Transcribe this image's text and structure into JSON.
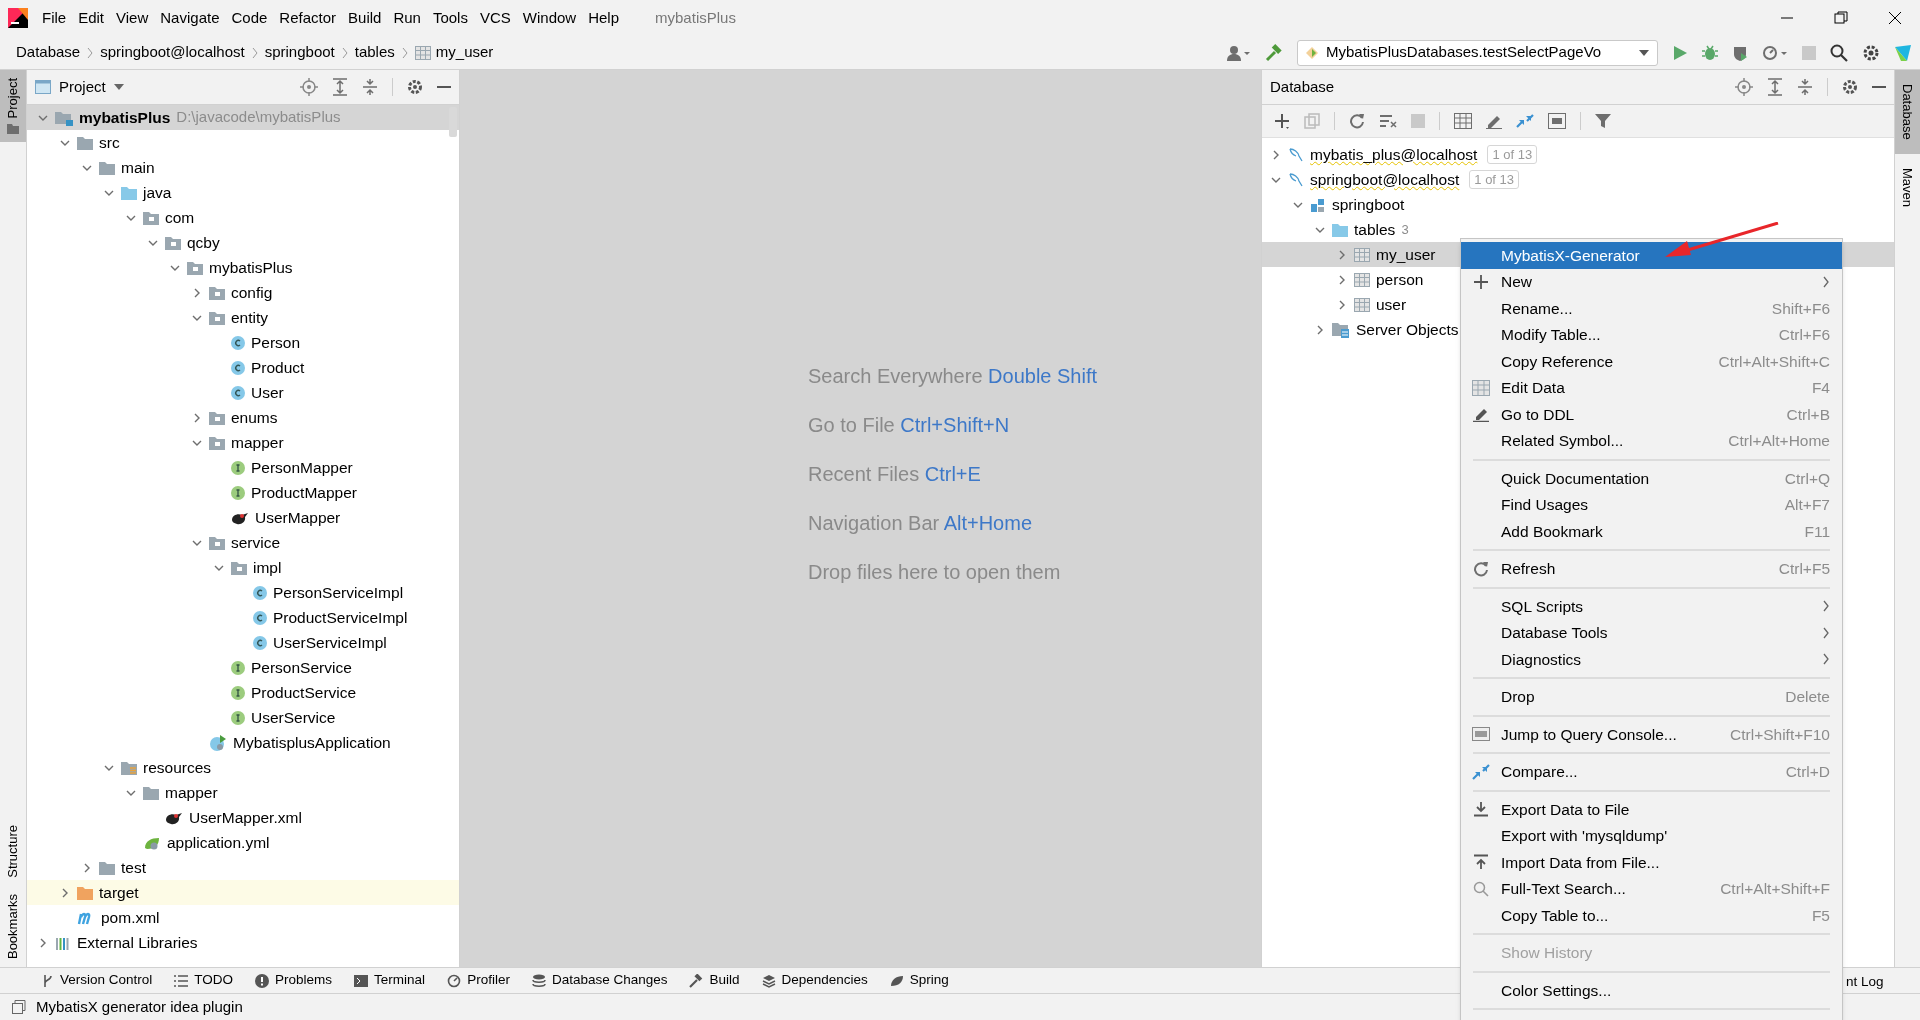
{
  "menu_bar": {
    "items": [
      "File",
      "Edit",
      "View",
      "Navigate",
      "Code",
      "Refactor",
      "Build",
      "Run",
      "Tools",
      "VCS",
      "Window",
      "Help"
    ],
    "project_title": "mybatisPlus"
  },
  "nav_bar": {
    "breadcrumbs": [
      {
        "label": "Database",
        "kind": "text"
      },
      {
        "label": "springboot@localhost",
        "kind": "text"
      },
      {
        "label": "springboot",
        "kind": "text"
      },
      {
        "label": "tables",
        "kind": "text"
      },
      {
        "label": "my_user",
        "kind": "table"
      }
    ],
    "run_config": "MybatisPlusDatabases.testSelectPageVo"
  },
  "left_stripe": {
    "top": [
      {
        "label": "Project",
        "selected": true
      }
    ],
    "bottom": [
      {
        "label": "Structure",
        "selected": false
      },
      {
        "label": "Bookmarks",
        "selected": false
      }
    ]
  },
  "project_panel": {
    "title": "Project",
    "tree": [
      {
        "label": "mybatisPlus",
        "kind": "module",
        "hint": "D:\\javacode\\mybatisPlus",
        "expanded": true,
        "selected": true,
        "children": [
          {
            "label": "src",
            "kind": "folder",
            "expanded": true,
            "selected": false,
            "children": [
              {
                "label": "main",
                "kind": "folder",
                "expanded": true,
                "selected": false,
                "children": [
                  {
                    "label": "java",
                    "kind": "source-folder",
                    "expanded": true,
                    "selected": false,
                    "children": [
                      {
                        "label": "com",
                        "kind": "package",
                        "expanded": true,
                        "selected": false,
                        "children": [
                          {
                            "label": "qcby",
                            "kind": "package",
                            "expanded": true,
                            "selected": false,
                            "children": [
                              {
                                "label": "mybatisPlus",
                                "kind": "package",
                                "expanded": true,
                                "selected": false,
                                "children": [
                                  {
                                    "label": "config",
                                    "kind": "package",
                                    "expanded": false,
                                    "selected": false
                                  },
                                  {
                                    "label": "entity",
                                    "kind": "package",
                                    "expanded": true,
                                    "selected": false,
                                    "children": [
                                      {
                                        "label": "Person",
                                        "kind": "class",
                                        "selected": false
                                      },
                                      {
                                        "label": "Product",
                                        "kind": "class",
                                        "selected": false
                                      },
                                      {
                                        "label": "User",
                                        "kind": "class",
                                        "selected": false
                                      }
                                    ]
                                  },
                                  {
                                    "label": "enums",
                                    "kind": "package",
                                    "expanded": false,
                                    "selected": false
                                  },
                                  {
                                    "label": "mapper",
                                    "kind": "package",
                                    "expanded": true,
                                    "selected": false,
                                    "children": [
                                      {
                                        "label": "PersonMapper",
                                        "kind": "interface",
                                        "selected": false
                                      },
                                      {
                                        "label": "ProductMapper",
                                        "kind": "interface",
                                        "selected": false
                                      },
                                      {
                                        "label": "UserMapper",
                                        "kind": "mybatis",
                                        "selected": false
                                      }
                                    ]
                                  },
                                  {
                                    "label": "service",
                                    "kind": "package",
                                    "expanded": true,
                                    "selected": false,
                                    "children": [
                                      {
                                        "label": "impl",
                                        "kind": "package",
                                        "expanded": true,
                                        "selected": false,
                                        "children": [
                                          {
                                            "label": "PersonServiceImpl",
                                            "kind": "class",
                                            "selected": false
                                          },
                                          {
                                            "label": "ProductServiceImpl",
                                            "kind": "class",
                                            "selected": false
                                          },
                                          {
                                            "label": "UserServiceImpl",
                                            "kind": "class",
                                            "selected": false
                                          }
                                        ]
                                      },
                                      {
                                        "label": "PersonService",
                                        "kind": "interface",
                                        "selected": false
                                      },
                                      {
                                        "label": "ProductService",
                                        "kind": "interface",
                                        "selected": false
                                      },
                                      {
                                        "label": "UserService",
                                        "kind": "interface",
                                        "selected": false
                                      }
                                    ]
                                  },
                                  {
                                    "label": "MybatisplusApplication",
                                    "kind": "spring-app",
                                    "selected": false
                                  }
                                ]
                              }
                            ]
                          }
                        ]
                      }
                    ]
                  },
                  {
                    "label": "resources",
                    "kind": "resources",
                    "expanded": true,
                    "selected": false,
                    "children": [
                      {
                        "label": "mapper",
                        "kind": "folder",
                        "expanded": true,
                        "selected": false,
                        "children": [
                          {
                            "label": "UserMapper.xml",
                            "kind": "mybatis",
                            "selected": false
                          }
                        ]
                      },
                      {
                        "label": "application.yml",
                        "kind": "yml",
                        "selected": false
                      }
                    ]
                  }
                ]
              },
              {
                "label": "test",
                "kind": "folder",
                "expanded": false,
                "selected": false
              }
            ]
          },
          {
            "label": "target",
            "kind": "excluded",
            "expanded": false,
            "selected": false
          },
          {
            "label": "pom.xml",
            "kind": "maven",
            "selected": false
          }
        ]
      },
      {
        "label": "External Libraries",
        "kind": "libraries",
        "expanded": false,
        "selected": false
      }
    ]
  },
  "editor_hints": [
    {
      "label": "Search Everywhere",
      "shortcut": "Double Shift"
    },
    {
      "label": "Go to File",
      "shortcut": "Ctrl+Shift+N"
    },
    {
      "label": "Recent Files",
      "shortcut": "Ctrl+E"
    },
    {
      "label": "Navigation Bar",
      "shortcut": "Alt+Home"
    },
    {
      "label": "Drop files here to open them"
    }
  ],
  "database_panel": {
    "title": "Database",
    "tree": [
      {
        "label": "mybatis_plus@localhost",
        "kind": "connection",
        "badge": "1 of 13",
        "expanded": false,
        "selected": false
      },
      {
        "label": "springboot@localhost",
        "kind": "connection",
        "badge": "1 of 13",
        "expanded": true,
        "selected": false,
        "children": [
          {
            "label": "springboot",
            "kind": "schema",
            "expanded": true,
            "selected": false,
            "children": [
              {
                "label": "tables",
                "kind": "source-folder",
                "count": "3",
                "expanded": true,
                "selected": false,
                "children": [
                  {
                    "label": "my_user",
                    "kind": "table",
                    "expanded": false,
                    "selected": true
                  },
                  {
                    "label": "person",
                    "kind": "table",
                    "expanded": false,
                    "selected": false
                  },
                  {
                    "label": "user",
                    "kind": "table",
                    "expanded": false,
                    "selected": false
                  }
                ]
              },
              {
                "label": "Server Objects",
                "kind": "server",
                "expanded": false,
                "selected": false
              }
            ]
          }
        ]
      }
    ]
  },
  "context_menu": {
    "items": [
      {
        "kind": "item",
        "label": "MybatisX-Generator",
        "selected": true,
        "disabled": false
      },
      {
        "kind": "add",
        "label": "New",
        "submenu": true,
        "selected": false,
        "disabled": false
      },
      {
        "kind": "item",
        "label": "Rename...",
        "shortcut": "Shift+F6",
        "selected": false,
        "disabled": false
      },
      {
        "kind": "item",
        "label": "Modify Table...",
        "shortcut": "Ctrl+F6",
        "selected": false,
        "disabled": false
      },
      {
        "kind": "item",
        "label": "Copy Reference",
        "shortcut": "Ctrl+Alt+Shift+C",
        "selected": false,
        "disabled": false
      },
      {
        "kind": "table",
        "label": "Edit Data",
        "shortcut": "F4",
        "selected": false,
        "disabled": false
      },
      {
        "kind": "edit",
        "label": "Go to DDL",
        "shortcut": "Ctrl+B",
        "selected": false,
        "disabled": false
      },
      {
        "kind": "item",
        "label": "Related Symbol...",
        "shortcut": "Ctrl+Alt+Home",
        "selected": false,
        "disabled": false
      },
      {
        "kind": "separator"
      },
      {
        "kind": "item",
        "label": "Quick Documentation",
        "shortcut": "Ctrl+Q",
        "selected": false,
        "disabled": false
      },
      {
        "kind": "item",
        "label": "Find Usages",
        "shortcut": "Alt+F7",
        "selected": false,
        "disabled": false
      },
      {
        "kind": "item",
        "label": "Add Bookmark",
        "shortcut": "F11",
        "selected": false,
        "disabled": false
      },
      {
        "kind": "separator"
      },
      {
        "kind": "refresh",
        "label": "Refresh",
        "shortcut": "Ctrl+F5",
        "selected": false,
        "disabled": false
      },
      {
        "kind": "separator"
      },
      {
        "kind": "item",
        "label": "SQL Scripts",
        "submenu": true,
        "selected": false,
        "disabled": false
      },
      {
        "kind": "item",
        "label": "Database Tools",
        "submenu": true,
        "selected": false,
        "disabled": false
      },
      {
        "kind": "item",
        "label": "Diagnostics",
        "submenu": true,
        "selected": false,
        "disabled": false
      },
      {
        "kind": "separator"
      },
      {
        "kind": "item",
        "label": "Drop",
        "shortcut": "Delete",
        "selected": false,
        "disabled": false
      },
      {
        "kind": "separator"
      },
      {
        "kind": "console",
        "label": "Jump to Query Console...",
        "shortcut": "Ctrl+Shift+F10",
        "selected": false,
        "disabled": false
      },
      {
        "kind": "separator"
      },
      {
        "kind": "compare",
        "label": "Compare...",
        "shortcut": "Ctrl+D",
        "selected": false,
        "disabled": false
      },
      {
        "kind": "separator"
      },
      {
        "kind": "export",
        "label": "Export Data to File",
        "selected": false,
        "disabled": false
      },
      {
        "kind": "item",
        "label": "Export with 'mysqldump'",
        "selected": false,
        "disabled": false
      },
      {
        "kind": "import",
        "label": "Import Data from File...",
        "selected": false,
        "disabled": false
      },
      {
        "kind": "search",
        "label": "Full-Text Search...",
        "shortcut": "Ctrl+Alt+Shift+F",
        "selected": false,
        "disabled": false
      },
      {
        "kind": "item",
        "label": "Copy Table to...",
        "shortcut": "F5",
        "selected": false,
        "disabled": false
      },
      {
        "kind": "separator"
      },
      {
        "kind": "item",
        "label": "Show History",
        "selected": false,
        "disabled": true
      },
      {
        "kind": "separator"
      },
      {
        "kind": "item",
        "label": "Color Settings...",
        "selected": false,
        "disabled": false
      },
      {
        "kind": "separator"
      }
    ]
  },
  "right_stripe": [
    {
      "label": "Database",
      "selected": true
    },
    {
      "label": "Maven",
      "selected": false
    }
  ],
  "bottom_tabs": [
    {
      "label": "Version Control",
      "kind": "branch"
    },
    {
      "label": "TODO",
      "kind": "list"
    },
    {
      "label": "Problems",
      "kind": "alert"
    },
    {
      "label": "Terminal",
      "kind": "terminal"
    },
    {
      "label": "Profiler",
      "kind": "gauge"
    },
    {
      "label": "Database Changes",
      "kind": "stack"
    },
    {
      "label": "Build",
      "kind": "hammer"
    },
    {
      "label": "Dependencies",
      "kind": "layers"
    },
    {
      "label": "Spring",
      "kind": "leaf"
    },
    {
      "label": "nt Log",
      "kind": "text"
    }
  ],
  "status_bar": {
    "message": "MybatisX generator idea plugin"
  }
}
